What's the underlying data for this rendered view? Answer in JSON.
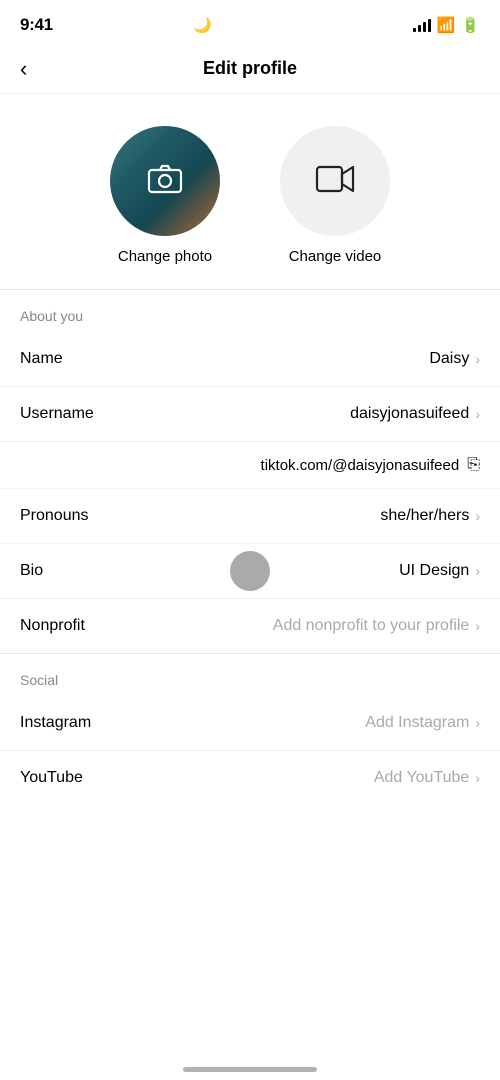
{
  "statusBar": {
    "time": "9:41",
    "moonIcon": "🌙"
  },
  "header": {
    "title": "Edit profile",
    "backLabel": "‹"
  },
  "profilePhoto": {
    "changePhotoLabel": "Change photo",
    "changeVideoLabel": "Change video"
  },
  "aboutSection": {
    "title": "About you",
    "rows": [
      {
        "label": "Name",
        "value": "Daisy",
        "muted": false
      },
      {
        "label": "Username",
        "value": "daisyjonasuifeed",
        "muted": false
      }
    ],
    "urlRow": {
      "url": "tiktok.com/@daisyjonasuifeed"
    },
    "rows2": [
      {
        "label": "Pronouns",
        "value": "she/her/hers",
        "muted": false
      },
      {
        "label": "Bio",
        "value": "UI Design",
        "muted": false
      },
      {
        "label": "Nonprofit",
        "value": "Add nonprofit to your profile",
        "muted": true
      }
    ]
  },
  "socialSection": {
    "title": "Social",
    "rows": [
      {
        "label": "Instagram",
        "value": "Add Instagram",
        "muted": true
      },
      {
        "label": "YouTube",
        "value": "Add YouTube",
        "muted": true
      }
    ]
  }
}
